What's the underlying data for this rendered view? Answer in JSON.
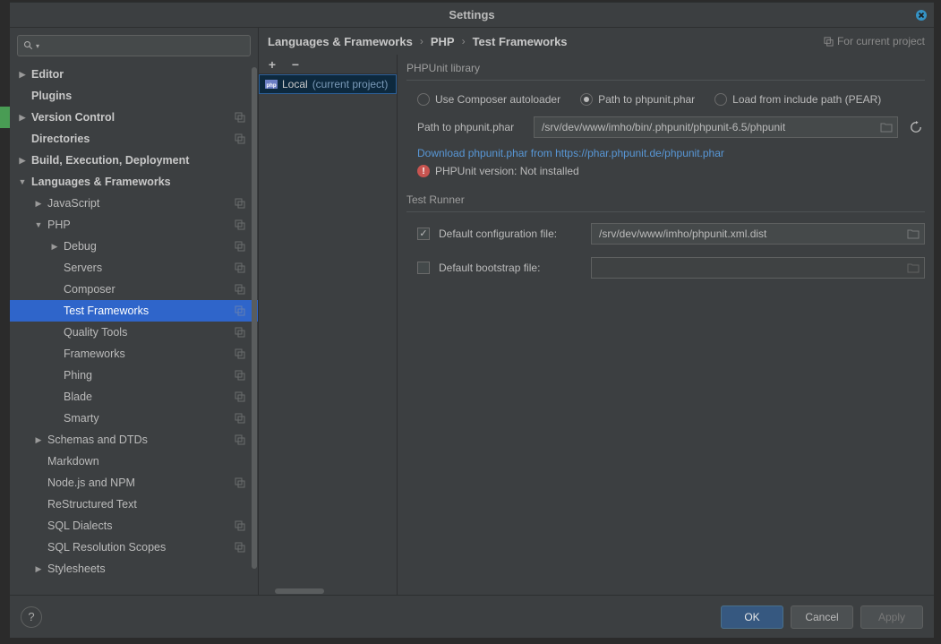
{
  "title": "Settings",
  "breadcrumb": [
    "Languages & Frameworks",
    "PHP",
    "Test Frameworks"
  ],
  "for_project": "For current project",
  "sidebar": {
    "items": [
      {
        "label": "Editor",
        "indent": 1,
        "arrow": "▶",
        "bold": true,
        "copy": false
      },
      {
        "label": "Plugins",
        "indent": 1,
        "arrow": "",
        "bold": true,
        "copy": false
      },
      {
        "label": "Version Control",
        "indent": 1,
        "arrow": "▶",
        "bold": true,
        "copy": true
      },
      {
        "label": "Directories",
        "indent": 1,
        "arrow": "",
        "bold": true,
        "copy": true
      },
      {
        "label": "Build, Execution, Deployment",
        "indent": 1,
        "arrow": "▶",
        "bold": true,
        "copy": false
      },
      {
        "label": "Languages & Frameworks",
        "indent": 1,
        "arrow": "▼",
        "bold": true,
        "copy": false
      },
      {
        "label": "JavaScript",
        "indent": 2,
        "arrow": "▶",
        "bold": false,
        "copy": true
      },
      {
        "label": "PHP",
        "indent": 2,
        "arrow": "▼",
        "bold": false,
        "copy": true
      },
      {
        "label": "Debug",
        "indent": 3,
        "arrow": "▶",
        "bold": false,
        "copy": true
      },
      {
        "label": "Servers",
        "indent": 3,
        "arrow": "",
        "bold": false,
        "copy": true
      },
      {
        "label": "Composer",
        "indent": 3,
        "arrow": "",
        "bold": false,
        "copy": true
      },
      {
        "label": "Test Frameworks",
        "indent": 3,
        "arrow": "",
        "bold": false,
        "copy": true,
        "selected": true
      },
      {
        "label": "Quality Tools",
        "indent": 3,
        "arrow": "",
        "bold": false,
        "copy": true
      },
      {
        "label": "Frameworks",
        "indent": 3,
        "arrow": "",
        "bold": false,
        "copy": true
      },
      {
        "label": "Phing",
        "indent": 3,
        "arrow": "",
        "bold": false,
        "copy": true
      },
      {
        "label": "Blade",
        "indent": 3,
        "arrow": "",
        "bold": false,
        "copy": true
      },
      {
        "label": "Smarty",
        "indent": 3,
        "arrow": "",
        "bold": false,
        "copy": true
      },
      {
        "label": "Schemas and DTDs",
        "indent": 2,
        "arrow": "▶",
        "bold": false,
        "copy": true
      },
      {
        "label": "Markdown",
        "indent": 2,
        "arrow": "",
        "bold": false,
        "copy": false
      },
      {
        "label": "Node.js and NPM",
        "indent": 2,
        "arrow": "",
        "bold": false,
        "copy": true
      },
      {
        "label": "ReStructured Text",
        "indent": 2,
        "arrow": "",
        "bold": false,
        "copy": false
      },
      {
        "label": "SQL Dialects",
        "indent": 2,
        "arrow": "",
        "bold": false,
        "copy": true
      },
      {
        "label": "SQL Resolution Scopes",
        "indent": 2,
        "arrow": "",
        "bold": false,
        "copy": true
      },
      {
        "label": "Stylesheets",
        "indent": 2,
        "arrow": "▶",
        "bold": false,
        "copy": false
      }
    ]
  },
  "middle": {
    "add": "+",
    "remove": "−",
    "item_label": "Local",
    "item_suffix": "(current project)"
  },
  "library": {
    "section": "PHPUnit library",
    "radio_composer": "Use Composer autoloader",
    "radio_phar": "Path to phpunit.phar",
    "radio_pear": "Load from include path (PEAR)",
    "path_label": "Path to phpunit.phar",
    "path_value": "/srv/dev/www/imho/bin/.phpunit/phpunit-6.5/phpunit",
    "download_link": "Download phpunit.phar from https://phar.phpunit.de/phpunit.phar",
    "status": "PHPUnit version: Not installed"
  },
  "runner": {
    "section": "Test Runner",
    "config_label": "Default configuration file:",
    "config_value": "/srv/dev/www/imho/phpunit.xml.dist",
    "bootstrap_label": "Default bootstrap file:",
    "bootstrap_value": ""
  },
  "footer": {
    "help": "?",
    "ok": "OK",
    "cancel": "Cancel",
    "apply": "Apply"
  }
}
